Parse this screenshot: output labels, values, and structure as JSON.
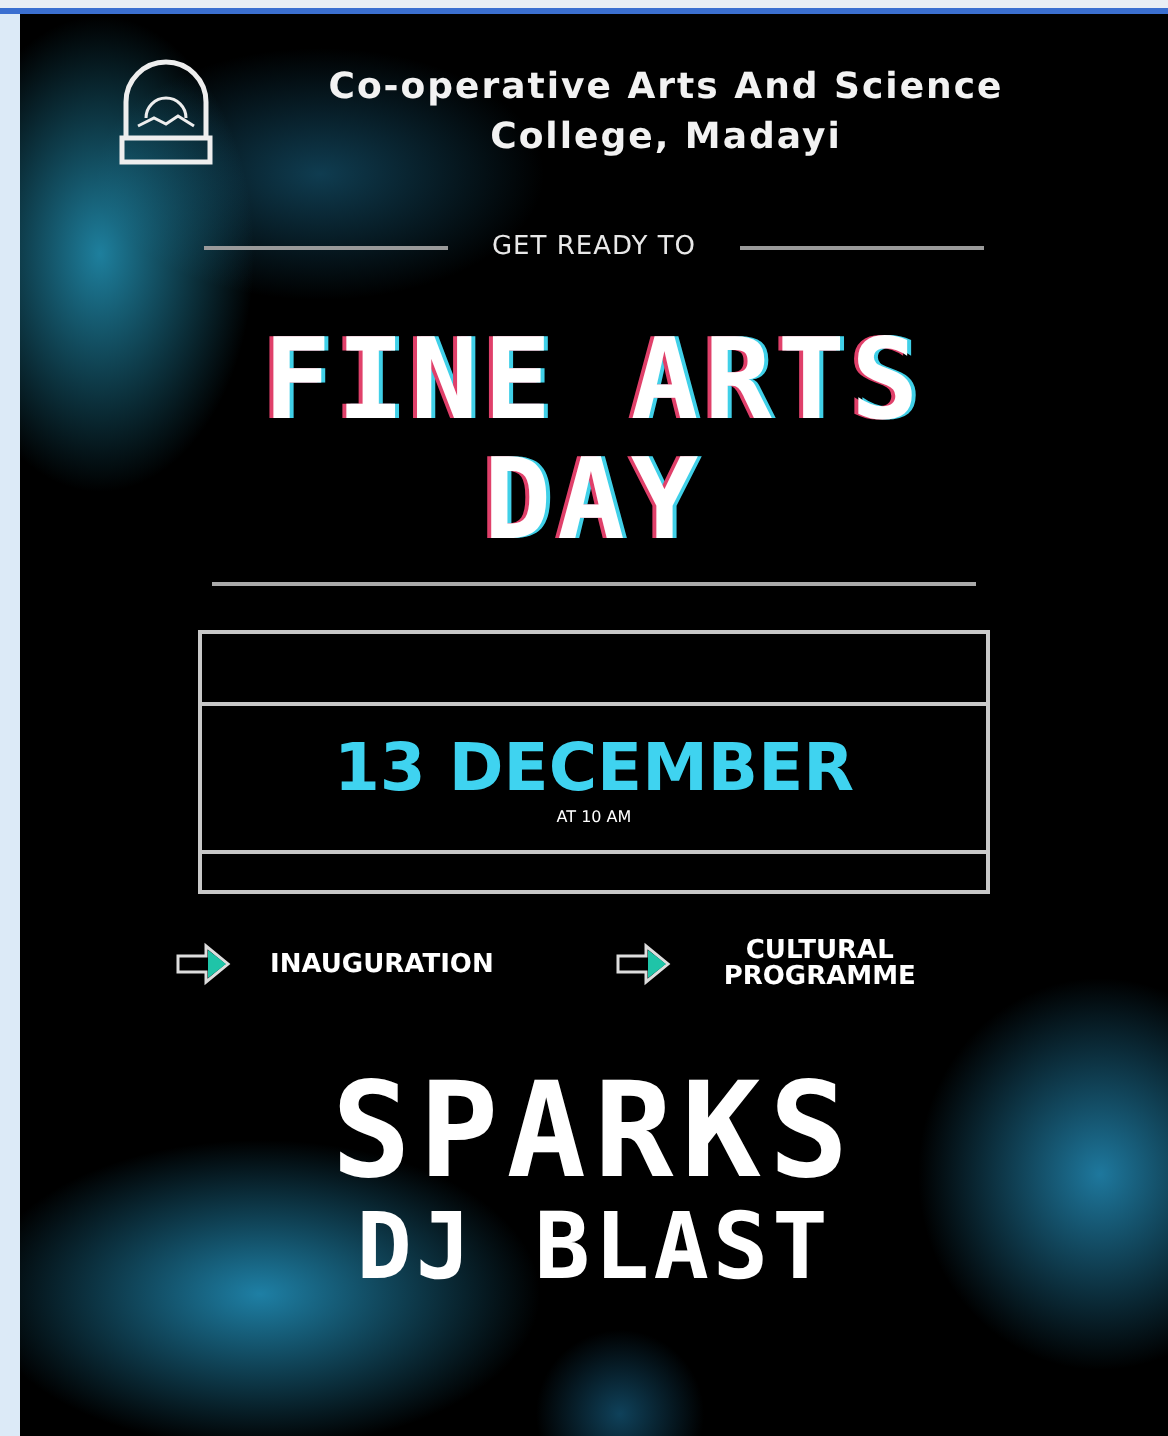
{
  "poster": {
    "college": [
      "Co-operative Arts And Science",
      "College, Madayi"
    ],
    "tagline": "GET READY TO",
    "title": [
      "FINE ARTS",
      "DAY"
    ],
    "date": "13 DECEMBER",
    "time": "AT 10 AM",
    "events": [
      {
        "label": "INAUGURATION"
      },
      {
        "label": "CULTURAL PROGRAMME"
      }
    ],
    "headline": "SPARKS",
    "subheadline": "DJ BLAST"
  }
}
